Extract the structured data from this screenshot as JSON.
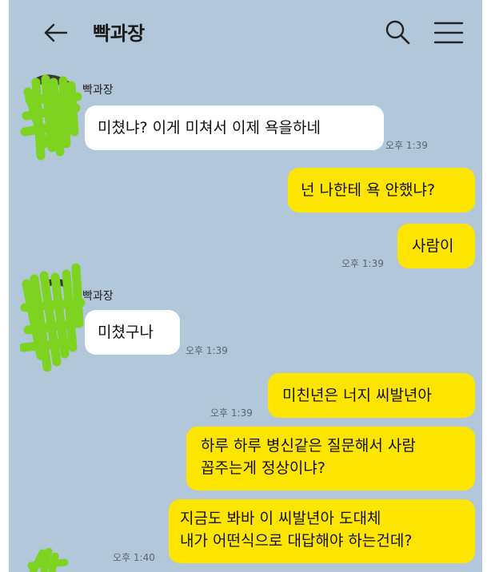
{
  "header": {
    "back_icon": "arrow-left-icon",
    "title": "빡과장",
    "search_icon": "search-icon",
    "menu_icon": "hamburger-menu-icon"
  },
  "colors": {
    "background": "#b2c7da",
    "incoming_bubble": "#ffffff",
    "outgoing_bubble": "#fee500",
    "avatar_scribble": "#7ed321"
  },
  "messages": [
    {
      "sender": "빡과장",
      "text": "미쳤냐? 이게 미쳐서 이제 욕을하네",
      "time": "오후 1:39",
      "direction": "incoming"
    },
    {
      "text": "넌 나한테 욕 안했냐?",
      "time": "",
      "direction": "outgoing"
    },
    {
      "text": "사람이",
      "time": "오후 1:39",
      "direction": "outgoing"
    },
    {
      "sender": "빡과장",
      "text": "미쳤구나",
      "time": "오후 1:39",
      "direction": "incoming"
    },
    {
      "text": "미친년은 너지 씨발년아",
      "time": "오후 1:39",
      "direction": "outgoing"
    },
    {
      "text": "하루 하루 병신같은 질문해서 사람\n꼽주는게 정상이냐?",
      "time": "",
      "direction": "outgoing"
    },
    {
      "text": "지금도 봐바 이 씨발년아 도대체\n내가 어떤식으로 대답해야 하는건데?",
      "time": "오후 1:40",
      "direction": "outgoing"
    }
  ]
}
